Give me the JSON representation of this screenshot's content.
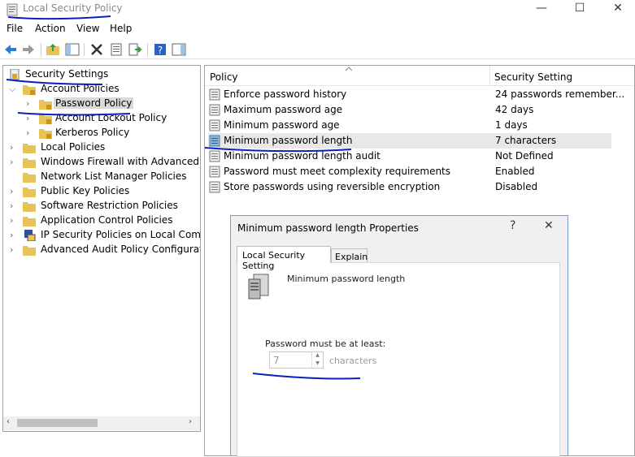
{
  "window": {
    "title": "Local Security Policy",
    "minimize": "—",
    "maximize": "☐",
    "close": "✕"
  },
  "menu": [
    "File",
    "Action",
    "View",
    "Help"
  ],
  "tree": {
    "root": "Security Settings",
    "items": [
      {
        "label": "Account Policies"
      },
      {
        "label": "Password Policy"
      },
      {
        "label": "Account Lockout Policy"
      },
      {
        "label": "Kerberos Policy"
      },
      {
        "label": "Local Policies"
      },
      {
        "label": "Windows Firewall with Advanced Secu"
      },
      {
        "label": "Network List Manager Policies"
      },
      {
        "label": "Public Key Policies"
      },
      {
        "label": "Software Restriction Policies"
      },
      {
        "label": "Application Control Policies"
      },
      {
        "label": "IP Security Policies on Local Compute"
      },
      {
        "label": "Advanced Audit Policy Configuration"
      }
    ]
  },
  "list": {
    "col_policy": "Policy",
    "col_setting": "Security Setting",
    "rows": [
      {
        "policy": "Enforce password history",
        "setting": "24 passwords remember..."
      },
      {
        "policy": "Maximum password age",
        "setting": "42 days"
      },
      {
        "policy": "Minimum password age",
        "setting": "1 days"
      },
      {
        "policy": "Minimum password length",
        "setting": "7 characters"
      },
      {
        "policy": "Minimum password length audit",
        "setting": "Not Defined"
      },
      {
        "policy": "Password must meet complexity requirements",
        "setting": "Enabled"
      },
      {
        "policy": "Store passwords using reversible encryption",
        "setting": "Disabled"
      }
    ]
  },
  "dialog": {
    "title": "Minimum password length Properties",
    "help": "?",
    "close": "✕",
    "tab_local": "Local Security Setting",
    "tab_explain": "Explain",
    "heading": "Minimum password length",
    "prompt": "Password must be at least:",
    "value": "7",
    "unit": "characters"
  },
  "colors": {
    "annotation": "#0a1fc2",
    "selection": "#d9d9d9",
    "highlight_row": "#e8e8e8"
  }
}
